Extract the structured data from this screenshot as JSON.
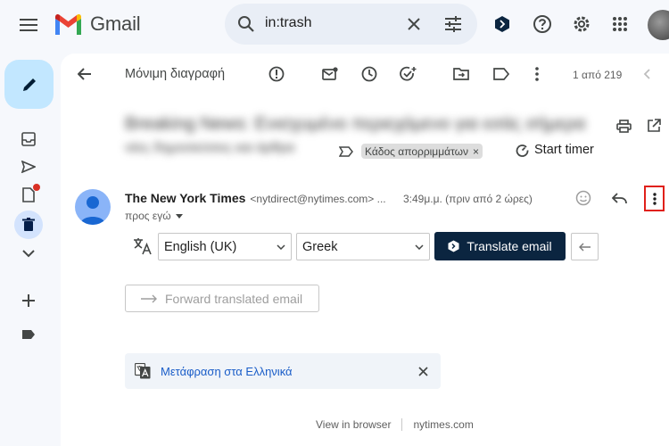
{
  "app": {
    "name": "Gmail"
  },
  "search": {
    "query": "in:trash"
  },
  "toolbar": {
    "delete_forever_label": "Μόνιμη διαγραφή",
    "page_counter": "1 από 219"
  },
  "email": {
    "subject_blurred": "Breaking News: Ενισχυμένο περιεχόμενο για εσάς σήμερα",
    "subject_blurred_line2": "νέες δημοσιεύσεις και άρθρα",
    "label_chip": "Κάδος απορριμμάτων",
    "start_timer": "Start timer",
    "sender_name": "The New York Times",
    "sender_email": "<nytdirect@nytimes.com> ...",
    "time": "3:49μ.μ. (πριν από 2 ώρες)",
    "to_me": "προς εγώ"
  },
  "translate": {
    "source_language": "English (UK)",
    "target_language": "Greek",
    "translate_button": "Translate email",
    "forward_button": "Forward translated email",
    "translation_link": "Μετάφραση στα Ελληνικά"
  },
  "footer": {
    "view_in_browser": "View in browser",
    "site": "nytimes.com"
  },
  "colors": {
    "compose_bg": "#c2e7ff",
    "translate_button_bg": "#0b2540",
    "link_blue": "#1a5dc8",
    "highlight_red": "#e0201a"
  }
}
